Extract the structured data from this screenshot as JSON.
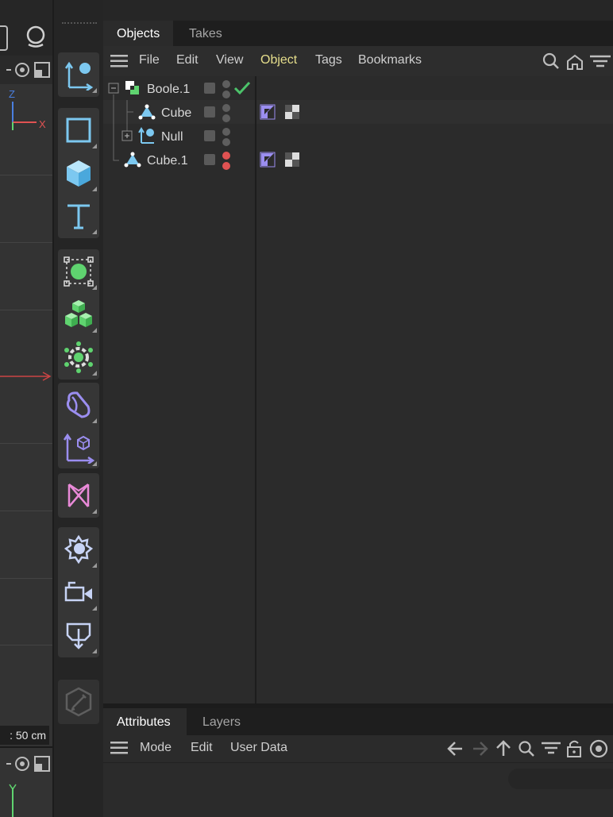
{
  "viewport": {
    "axis_z": "Z",
    "axis_x": "X",
    "axis_y": "Y",
    "scale_label": ": 50 cm"
  },
  "object_manager": {
    "tabs": [
      {
        "label": "Objects",
        "active": true
      },
      {
        "label": "Takes",
        "active": false
      }
    ],
    "menu": [
      "File",
      "Edit",
      "View",
      "Object",
      "Tags",
      "Bookmarks"
    ],
    "highlighted_menu": "Object",
    "objects": [
      {
        "name": "Boole.1",
        "icon": "boole-icon",
        "state_check": true
      },
      {
        "name": "Cube",
        "icon": "cube-primitive-icon",
        "tags": [
          "phong-tag-icon",
          "material-tag-icon"
        ]
      },
      {
        "name": "Null",
        "icon": "null-icon",
        "collapsed": true
      },
      {
        "name": "Cube.1",
        "icon": "cube-primitive-icon",
        "disabled": true,
        "tags": [
          "phong-tag-icon",
          "material-tag-icon"
        ]
      }
    ]
  },
  "attributes": {
    "tabs": [
      {
        "label": "Attributes",
        "active": true
      },
      {
        "label": "Layers",
        "active": false
      }
    ],
    "menu": [
      "Mode",
      "Edit",
      "User Data"
    ]
  },
  "colors": {
    "accent_yellow": "#e6de8c",
    "check_green": "#4cc36a",
    "dot_red": "#e05252",
    "icon_blue": "#7cc8f0",
    "icon_green": "#5fd36f",
    "icon_purple": "#9b8ef0",
    "icon_pink": "#e98ad8"
  }
}
